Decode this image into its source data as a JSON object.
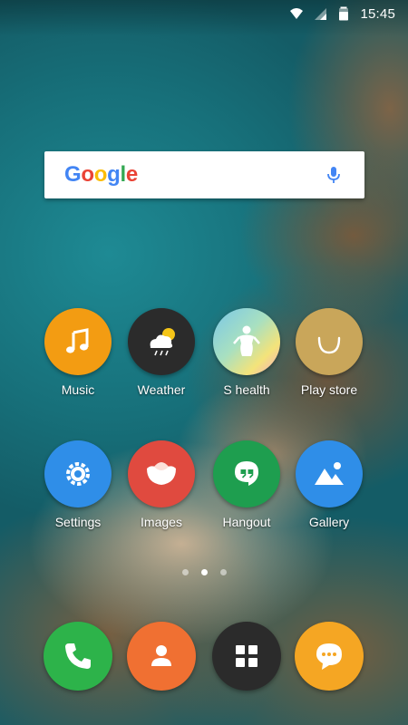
{
  "status_bar": {
    "time": "15:45"
  },
  "search": {
    "logo_text": "Google"
  },
  "apps": {
    "music": {
      "label": "Music",
      "icon": "music-note-icon",
      "color": "#F39C12"
    },
    "weather": {
      "label": "Weather",
      "icon": "weather-icon",
      "color": "#2B2B2B"
    },
    "s_health": {
      "label": "S health",
      "icon": "s-health-icon",
      "color": "#7AC7E8"
    },
    "play_store": {
      "label": "Play store",
      "icon": "play-store-icon",
      "color": "#C9A65A"
    },
    "settings": {
      "label": "Settings",
      "icon": "gear-icon",
      "color": "#2F8EE8"
    },
    "images": {
      "label": "Images",
      "icon": "images-icon",
      "color": "#E04A3F"
    },
    "hangout": {
      "label": "Hangout",
      "icon": "hangout-icon",
      "color": "#1E9E4F"
    },
    "gallery": {
      "label": "Gallery",
      "icon": "gallery-icon",
      "color": "#2F8EE8"
    }
  },
  "dock": {
    "phone": {
      "icon": "phone-icon",
      "color": "#2DB34A"
    },
    "contacts": {
      "icon": "contacts-icon",
      "color": "#F07032"
    },
    "app_drawer": {
      "icon": "app-drawer-icon",
      "color": "#2B2B2B"
    },
    "messages": {
      "icon": "messages-icon",
      "color": "#F5A623"
    }
  },
  "page_indicator": {
    "pages": 3,
    "active_index": 1
  }
}
